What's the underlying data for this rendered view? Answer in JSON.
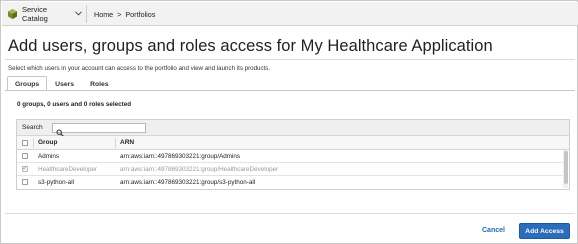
{
  "nav": {
    "service_label": "Service Catalog",
    "service_icon": "service-catalog-icon",
    "chevron_icon": "chevron-down-icon",
    "breadcrumb_home": "Home",
    "breadcrumb_sep": ">",
    "breadcrumb_portfolios": "Portfolios"
  },
  "page": {
    "title": "Add users, groups and roles access for My Healthcare Application",
    "subtitle": "Select which users in your account can access to the portfolio and view and launch its products."
  },
  "tabs": [
    {
      "label": "Groups",
      "active": true
    },
    {
      "label": "Users",
      "active": false
    },
    {
      "label": "Roles",
      "active": false
    }
  ],
  "selection_summary": "0 groups, 0 users and 0 roles selected",
  "table": {
    "search_label": "Search",
    "search_value": "",
    "columns": [
      "Group",
      "ARN"
    ],
    "rows": [
      {
        "group": "Admins",
        "arn": "arn:aws:iam::497869303221:group/Admins",
        "checked": false,
        "disabled": false
      },
      {
        "group": "HealthcareDeveloper",
        "arn": "arn:aws:iam::497869303221:group/HealthcareDeveloper",
        "checked": true,
        "disabled": true
      },
      {
        "group": "s3-python-all",
        "arn": "arn:aws:iam::497869303221:group/s3-python-all",
        "checked": false,
        "disabled": false
      }
    ]
  },
  "footer": {
    "cancel_label": "Cancel",
    "add_label": "Add Access",
    "accent_color": "#2b6dbb"
  }
}
